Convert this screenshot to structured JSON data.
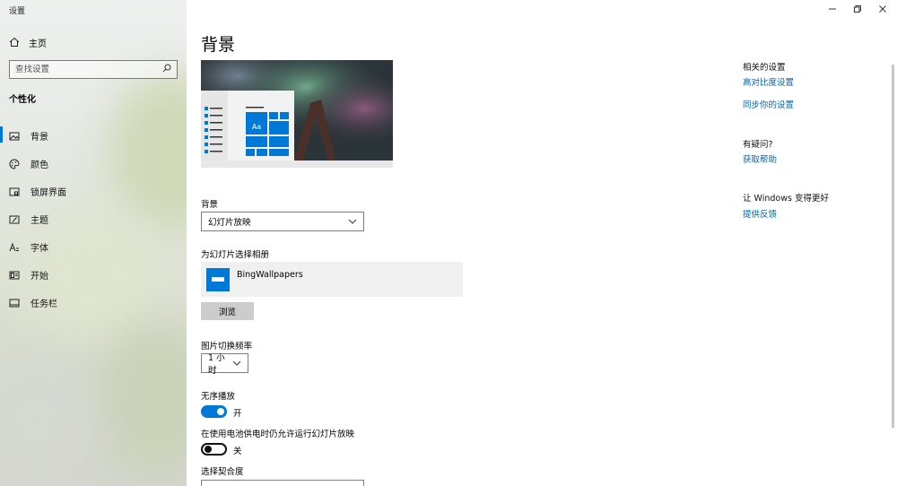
{
  "window": {
    "title": "设置",
    "controls": [
      "minimize-icon",
      "restore-icon",
      "close-icon"
    ]
  },
  "sidebar": {
    "home_label": "主页",
    "search_placeholder": "查找设置",
    "section_title": "个性化",
    "items": [
      {
        "label": "背景",
        "icon": "picture-icon",
        "active": true
      },
      {
        "label": "颜色",
        "icon": "palette-icon",
        "active": false
      },
      {
        "label": "锁屏界面",
        "icon": "lock-screen-icon",
        "active": false
      },
      {
        "label": "主题",
        "icon": "theme-icon",
        "active": false
      },
      {
        "label": "字体",
        "icon": "font-icon",
        "active": false
      },
      {
        "label": "开始",
        "icon": "start-icon",
        "active": false
      },
      {
        "label": "任务栏",
        "icon": "taskbar-icon",
        "active": false
      }
    ]
  },
  "main": {
    "title": "背景",
    "preview_tile_label": "Aa",
    "background_label": "背景",
    "background_value": "幻灯片放映",
    "album_label": "为幻灯片选择相册",
    "album_name": "BingWallpapers",
    "browse_label": "浏览",
    "interval_label": "图片切换频率",
    "interval_value": "1 小时",
    "shuffle_label": "无序播放",
    "shuffle_state": "开",
    "shuffle_on": true,
    "battery_label": "在使用电池供电时仍允许运行幻灯片放映",
    "battery_state": "关",
    "battery_on": false,
    "fit_label": "选择契合度"
  },
  "rail": {
    "related_title": "相关的设置",
    "related_links": [
      "高对比度设置",
      "同步你的设置"
    ],
    "question_title": "有疑问?",
    "help_link": "获取帮助",
    "feedback_title": "让 Windows 变得更好",
    "feedback_link": "提供反馈"
  },
  "colors": {
    "accent": "#0078d7",
    "link": "#0063b1"
  }
}
